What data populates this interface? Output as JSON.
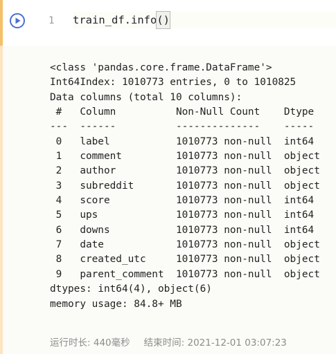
{
  "input": {
    "line_number": "1",
    "code_prefix": "train_df.info",
    "code_parens": "()"
  },
  "output": {
    "lines": [
      "<class 'pandas.core.frame.DataFrame'>",
      "Int64Index: 1010773 entries, 0 to 1010825",
      "Data columns (total 10 columns):",
      " #   Column          Non-Null Count    Dtype ",
      "---  ------          --------------    ----- ",
      " 0   label           1010773 non-null  int64 ",
      " 1   comment         1010773 non-null  object",
      " 2   author          1010773 non-null  object",
      " 3   subreddit       1010773 non-null  object",
      " 4   score           1010773 non-null  int64 ",
      " 5   ups             1010773 non-null  int64 ",
      " 6   downs           1010773 non-null  int64 ",
      " 7   date            1010773 non-null  object",
      " 8   created_utc     1010773 non-null  object",
      " 9   parent_comment  1010773 non-null  object",
      "dtypes: int64(4), object(6)",
      "memory usage: 84.8+ MB"
    ]
  },
  "footer": {
    "runtime_label": "运行时长:",
    "runtime_value": "440毫秒",
    "end_time_label": "结束时间:",
    "end_time_value": "2021-12-01 03:07:23"
  },
  "colors": {
    "input_border": "#f4c069",
    "output_border": "#fde4c2",
    "run_icon": "#4a6fd1"
  },
  "icons": {
    "run": "play-circle-icon"
  }
}
